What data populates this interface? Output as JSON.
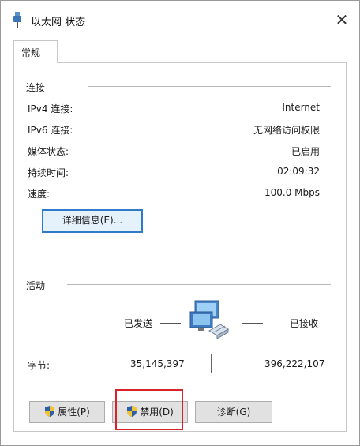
{
  "window": {
    "title": "以太网 状态",
    "close_glyph": "✕"
  },
  "tabs": [
    {
      "label": "常规"
    }
  ],
  "connection": {
    "heading": "连接",
    "rows": [
      {
        "label": "IPv4 连接:",
        "value": "Internet"
      },
      {
        "label": "IPv6 连接:",
        "value": "无网络访问权限"
      },
      {
        "label": "媒体状态:",
        "value": "已启用"
      },
      {
        "label": "持续时间:",
        "value": "02:09:32"
      },
      {
        "label": "速度:",
        "value": "100.0 Mbps"
      }
    ],
    "details_button": "详细信息(E)..."
  },
  "activity": {
    "heading": "活动",
    "sent_label": "已发送",
    "received_label": "已接收",
    "bytes_label": "字节:",
    "bytes_sent": "35,145,397",
    "bytes_received": "396,222,107"
  },
  "buttons": {
    "properties": "属性(P)",
    "disable": "禁用(D)",
    "diagnose": "诊断(G)"
  },
  "colors": {
    "accent": "#2f7bc9",
    "highlight_box": "#d9232a"
  }
}
